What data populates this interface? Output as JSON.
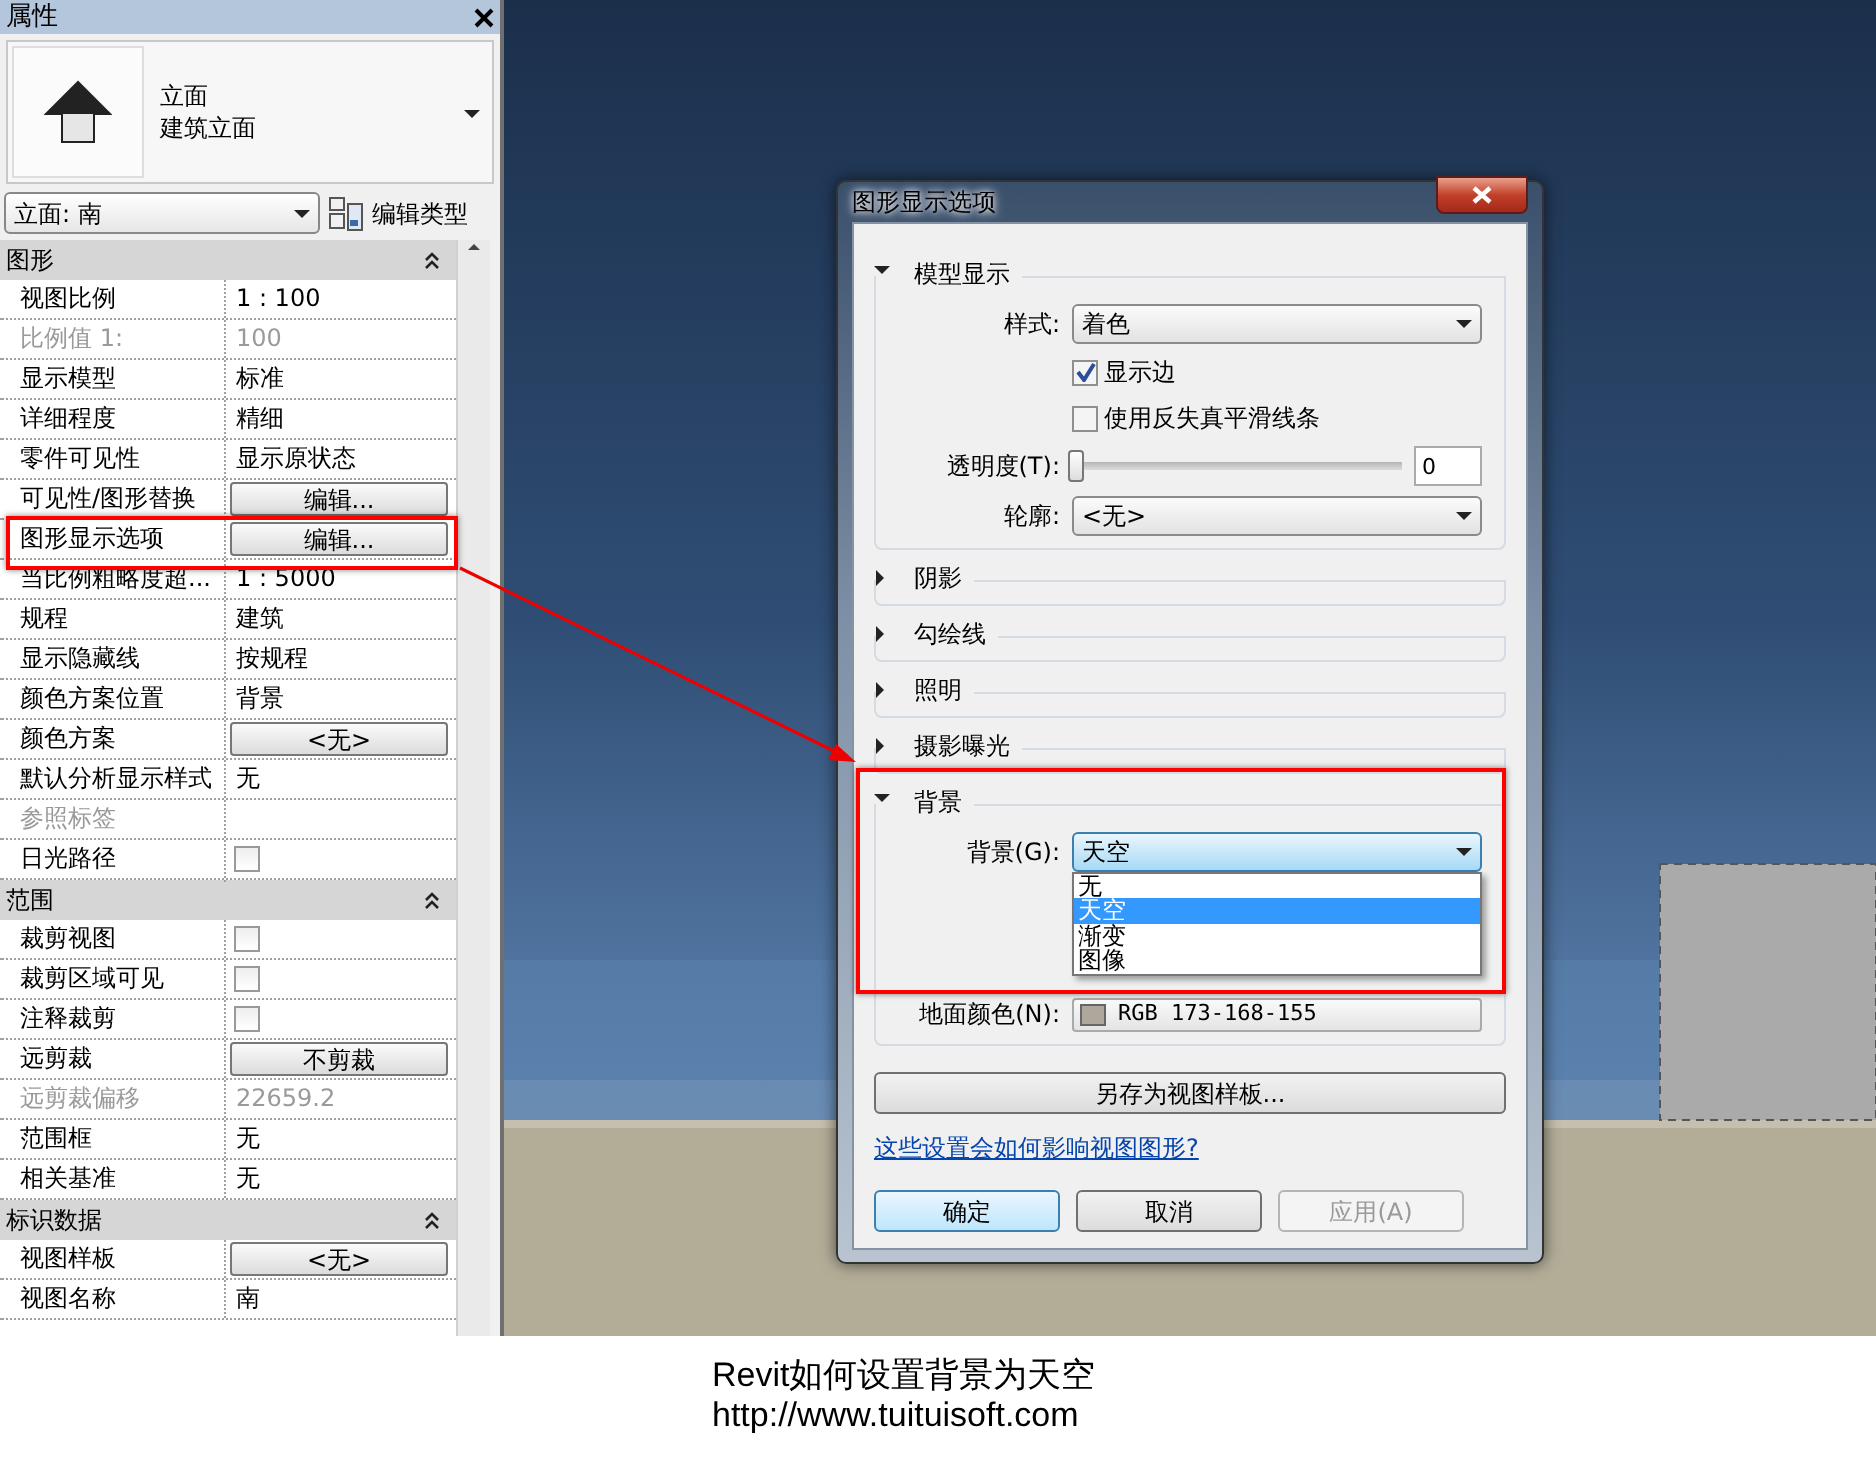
{
  "properties_panel": {
    "title": "属性",
    "type_selector": {
      "lines": [
        "立面",
        "建筑立面"
      ]
    },
    "instance_dropdown": "立面: 南",
    "edit_type_button": "编辑类型",
    "sections": [
      {
        "title": "图形",
        "expanded": true,
        "rows": [
          {
            "name": "视图比例",
            "kind": "text",
            "value": "1 : 100",
            "disabled": false
          },
          {
            "name": "比例值 1:",
            "kind": "text",
            "value": "100",
            "disabled": true
          },
          {
            "name": "显示模型",
            "kind": "text",
            "value": "标准",
            "disabled": false
          },
          {
            "name": "详细程度",
            "kind": "text",
            "value": "精细",
            "disabled": false
          },
          {
            "name": "零件可见性",
            "kind": "text",
            "value": "显示原状态",
            "disabled": false
          },
          {
            "name": "可见性/图形替换",
            "kind": "button",
            "value": "编辑...",
            "disabled": false
          },
          {
            "name": "图形显示选项",
            "kind": "button",
            "value": "编辑...",
            "disabled": false
          },
          {
            "name": "当比例粗略度超...",
            "kind": "text",
            "value": "1 : 5000",
            "disabled": false
          },
          {
            "name": "规程",
            "kind": "text",
            "value": "建筑",
            "disabled": false
          },
          {
            "name": "显示隐藏线",
            "kind": "text",
            "value": "按规程",
            "disabled": false
          },
          {
            "name": "颜色方案位置",
            "kind": "text",
            "value": "背景",
            "disabled": false
          },
          {
            "name": "颜色方案",
            "kind": "button",
            "value": "<无>",
            "disabled": false
          },
          {
            "name": "默认分析显示样式",
            "kind": "text",
            "value": "无",
            "disabled": false
          },
          {
            "name": "参照标签",
            "kind": "text",
            "disabled": true
          },
          {
            "name": "日光路径",
            "kind": "checkbox",
            "checked": false,
            "disabled": false
          }
        ]
      },
      {
        "title": "范围",
        "expanded": true,
        "rows": [
          {
            "name": "裁剪视图",
            "kind": "checkbox",
            "checked": false,
            "disabled": false
          },
          {
            "name": "裁剪区域可见",
            "kind": "checkbox",
            "checked": false,
            "disabled": false
          },
          {
            "name": "注释裁剪",
            "kind": "checkbox",
            "checked": false,
            "disabled": false
          },
          {
            "name": "远剪裁",
            "kind": "button",
            "value": "不剪裁",
            "disabled": false
          },
          {
            "name": "远剪裁偏移",
            "kind": "text",
            "value": "22659.2",
            "disabled": true
          },
          {
            "name": "范围框",
            "kind": "text",
            "value": "无",
            "disabled": false
          },
          {
            "name": "相关基准",
            "kind": "text",
            "value": "无",
            "disabled": false
          }
        ]
      },
      {
        "title": "标识数据",
        "expanded": true,
        "rows": [
          {
            "name": "视图样板",
            "kind": "button",
            "value": "<无>",
            "disabled": false
          },
          {
            "name": "视图名称",
            "kind": "text",
            "value": "南",
            "disabled": false
          }
        ]
      }
    ]
  },
  "dialog": {
    "title": "图形显示选项",
    "sections": [
      {
        "title": "模型显示",
        "expanded": true,
        "kind": "model",
        "style": {
          "label": "样式:",
          "value": "着色"
        },
        "checkboxes": [
          {
            "label": "显示边",
            "checked": true
          },
          {
            "label": "使用反失真平滑线条",
            "checked": false
          }
        ],
        "transparency": {
          "label": "透明度(T):",
          "level": 0,
          "value": "0"
        },
        "silhouette": {
          "label": "轮廓:",
          "value": "<无>"
        }
      },
      {
        "title": "阴影",
        "expanded": false
      },
      {
        "title": "勾绘线",
        "expanded": false
      },
      {
        "title": "照明",
        "expanded": false
      },
      {
        "title": "摄影曝光",
        "expanded": false
      },
      {
        "title": "背景",
        "expanded": true,
        "kind": "background",
        "background": {
          "label": "背景(G):",
          "value": "天空",
          "open": true,
          "options": [
            {
              "label": "无",
              "selected": false
            },
            {
              "label": "天空",
              "selected": true
            },
            {
              "label": "渐变",
              "selected": false
            },
            {
              "label": "图像",
              "selected": false
            }
          ]
        },
        "ground_color": {
          "label": "地面颜色(N):",
          "value": "RGB 173-168-155",
          "color": "#ada89b"
        }
      }
    ],
    "save_template_button": "另存为视图样板...",
    "help_link": "这些设置会如何影响视图图形?",
    "buttons": [
      {
        "label": "确定",
        "kind": "default",
        "disabled": false
      },
      {
        "label": "取消",
        "kind": "normal",
        "disabled": false
      },
      {
        "label": "应用(A)",
        "kind": "normal",
        "disabled": true
      }
    ]
  },
  "caption": [
    "Revit如何设置背景为天空",
    "http://www.tuituisoft.com"
  ]
}
